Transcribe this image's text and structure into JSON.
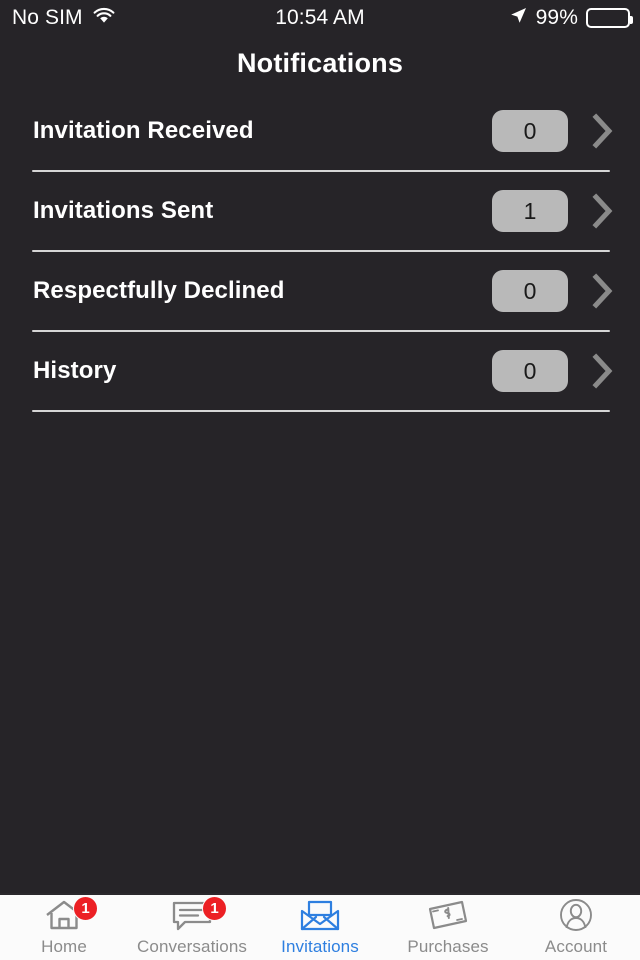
{
  "status_bar": {
    "carrier": "No SIM",
    "wifi_icon": "wifi-icon",
    "time": "10:54 AM",
    "location_icon": "location-arrow-icon",
    "battery_percent": "99%",
    "battery_icon": "battery-icon"
  },
  "header": {
    "title": "Notifications"
  },
  "list": {
    "rows": [
      {
        "label": "Invitation Received",
        "count": "0",
        "chevron_icon": "chevron-right-icon"
      },
      {
        "label": "Invitations Sent",
        "count": "1",
        "chevron_icon": "chevron-right-icon"
      },
      {
        "label": "Respectfully Declined",
        "count": "0",
        "chevron_icon": "chevron-right-icon"
      },
      {
        "label": "History",
        "count": "0",
        "chevron_icon": "chevron-right-icon"
      }
    ]
  },
  "tabbar": {
    "tabs": [
      {
        "label": "Home",
        "icon": "home-icon",
        "badge": "1",
        "active": false
      },
      {
        "label": "Conversations",
        "icon": "chat-bubble-icon",
        "badge": "1",
        "active": false
      },
      {
        "label": "Invitations",
        "icon": "open-envelope-icon",
        "badge": "",
        "active": true
      },
      {
        "label": "Purchases",
        "icon": "dollar-bill-icon",
        "badge": "",
        "active": false
      },
      {
        "label": "Account",
        "icon": "person-circle-icon",
        "badge": "",
        "active": false
      }
    ]
  },
  "colors": {
    "background": "#262428",
    "accent": "#2e7fe0",
    "badge_red": "#ec2024",
    "count_pill": "#b9b9b9",
    "divider": "#d6d6d6",
    "inactive_tab": "#8b8b8b"
  }
}
